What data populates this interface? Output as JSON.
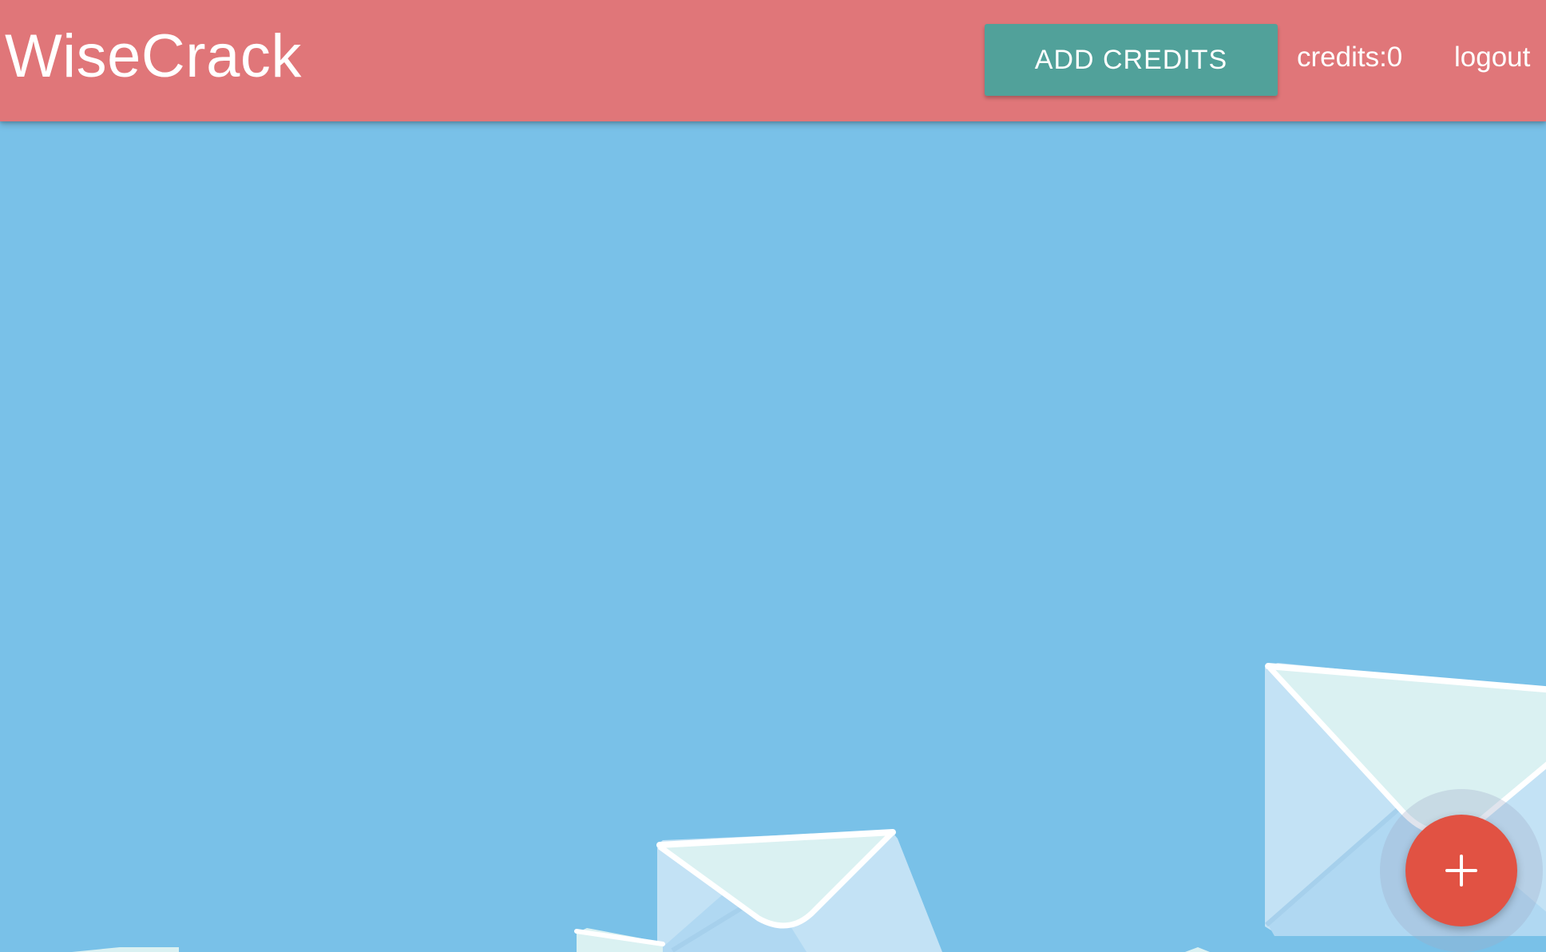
{
  "navbar": {
    "brand": "WiseCrack",
    "add_credits_label": "ADD CREDITS",
    "credits_text": "credits:0",
    "logout_label": "logout"
  },
  "fab": {
    "icon": "plus-icon"
  },
  "colors": {
    "navbar": "#e07679",
    "add_credits_button": "#51a19a",
    "background": "#79c1e8",
    "fab": "#e15243"
  }
}
